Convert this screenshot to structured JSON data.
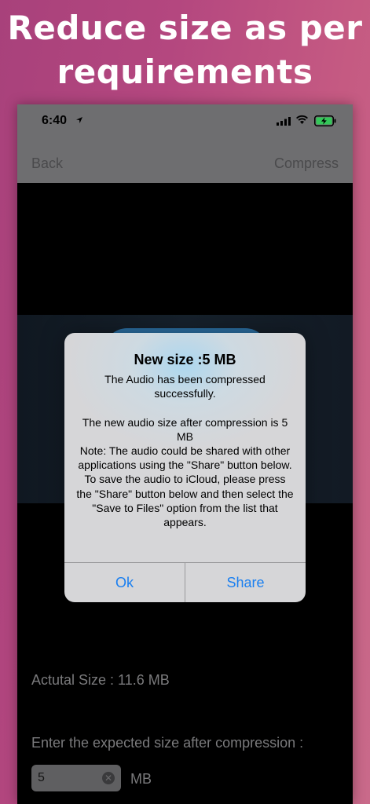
{
  "headline": {
    "line1": "Reduce size as per",
    "line2": "requirements"
  },
  "status_bar": {
    "time": "6:40",
    "icons": [
      "location-arrow-icon",
      "cellular-signal-icon",
      "wifi-icon",
      "battery-charging-icon"
    ]
  },
  "nav": {
    "back_label": "Back",
    "compress_label": "Compress"
  },
  "main": {
    "actual_size_text": "Actutal Size : 11.6 MB",
    "expected_label": "Enter the expected size after compression :",
    "size_input_value": "5",
    "unit_label": "MB"
  },
  "alert": {
    "title": "New size :5 MB",
    "message": "The Audio has been compressed successfully.\n\nThe new audio size after compression is 5 MB\nNote: The audio could be shared with other applications using the \"Share\" button below.\nTo save the audio to iCloud, please press the \"Share\" button below and then select the \"Save to Files\" option from the list that appears.",
    "ok_label": "Ok",
    "share_label": "Share"
  },
  "colors": {
    "accent_blue": "#1a7ff0",
    "background_pink": "#b4477f",
    "battery_green": "#34c759"
  }
}
